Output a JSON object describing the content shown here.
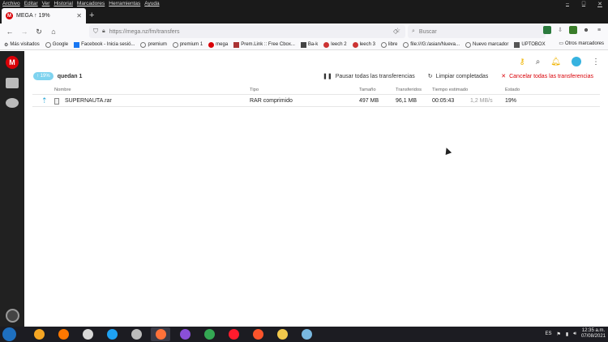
{
  "menu": [
    "Archivo",
    "Editar",
    "Ver",
    "Historial",
    "Marcadores",
    "Herramientas",
    "Ayuda"
  ],
  "tab": {
    "title": "MEGA ↑ 19%",
    "favicon_letter": "M"
  },
  "url": "https://mega.nz/fm/transfers",
  "search_placeholder": "Buscar",
  "bookmarks": [
    {
      "label": "Más visitados",
      "icon": "gear-icon"
    },
    {
      "label": "Google",
      "icon": "globe-icon"
    },
    {
      "label": "Facebook - Inicia sesió...",
      "icon": "facebook-icon"
    },
    {
      "label": "premium",
      "icon": "globe-icon"
    },
    {
      "label": "premium 1",
      "icon": "globe-icon"
    },
    {
      "label": "mega",
      "icon": "mega-icon"
    },
    {
      "label": "Prem.Link :: Free Cbox...",
      "icon": "premlink-icon"
    },
    {
      "label": "Ba-k",
      "icon": "ba-k-icon"
    },
    {
      "label": "leech 2",
      "icon": "leech-icon"
    },
    {
      "label": "leech 3",
      "icon": "leech-icon"
    },
    {
      "label": "libre",
      "icon": "globe-icon"
    },
    {
      "label": "file:///G:/asian/Nueva...",
      "icon": "globe-icon"
    },
    {
      "label": "Nuevo marcador",
      "icon": "globe-icon"
    },
    {
      "label": "UPTOBOX",
      "icon": "uptobox-icon"
    }
  ],
  "bookmarks_other": "Otros marcadores",
  "mega": {
    "logo": "M",
    "summary": {
      "percent": "19%",
      "remaining": "quedan 1"
    },
    "actions": {
      "pause": "Pausar todas las transferencias",
      "clear": "Limpiar completadas",
      "cancel": "Cancelar todas las transferencias"
    },
    "columns": {
      "name": "Nombre",
      "type": "Tipo",
      "size": "Tamaño",
      "transferred": "Transferidos",
      "eta": "Tiempo estimado",
      "status": "Estado"
    },
    "rows": [
      {
        "name": "SUPERNAUTA.rar",
        "type": "RAR comprimido",
        "size": "497 MB",
        "transferred": "96,1 MB",
        "eta": "00:05:43",
        "speed": "1,2 MB/s",
        "status": "19%"
      }
    ]
  },
  "taskbar": {
    "lang": "ES",
    "time": "12:35 a.m.",
    "date": "07/08/2021",
    "apps": [
      {
        "name": "media-player-icon",
        "color": "#f5a623"
      },
      {
        "name": "avast-icon",
        "color": "#ff7800"
      },
      {
        "name": "video-icon",
        "color": "#d8d8d8"
      },
      {
        "name": "ie-icon",
        "color": "#1ea1f2"
      },
      {
        "name": "tool-icon",
        "color": "#bbbbbb"
      },
      {
        "name": "firefox-icon",
        "color": "#ff7139",
        "active": true
      },
      {
        "name": "podcast-icon",
        "color": "#8a4fd8"
      },
      {
        "name": "chrome-icon",
        "color": "#34a853"
      },
      {
        "name": "opera-icon",
        "color": "#ff1b2d"
      },
      {
        "name": "brave-icon",
        "color": "#fb542b"
      },
      {
        "name": "folder-icon",
        "color": "#f2c94c"
      },
      {
        "name": "app-icon",
        "color": "#79b8e0"
      }
    ]
  }
}
